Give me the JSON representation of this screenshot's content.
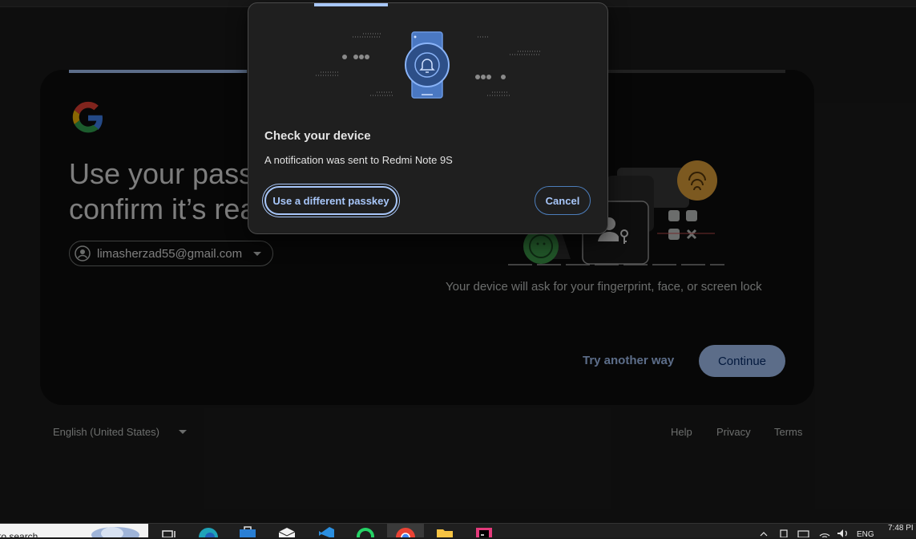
{
  "signin": {
    "headline": "Use your pass\nconfirm it’s rea",
    "account_email": "limasherzad55@gmail.com",
    "device_note": "Your device will ask for your fingerprint, face, or screen lock",
    "try_another": "Try another way",
    "continue": "Continue"
  },
  "footer": {
    "language": "English (United States)",
    "help": "Help",
    "privacy": "Privacy",
    "terms": "Terms"
  },
  "dialog": {
    "title": "Check your device",
    "body": "A notification was sent to Redmi Note 9S",
    "use_different_passkey": "Use a different passkey",
    "cancel": "Cancel"
  },
  "taskbar": {
    "search_text": "to search",
    "tray_lang": "ENG",
    "clock": "7:48 PI"
  },
  "colors": {
    "accent": "#a8c7fa",
    "background": "#1b1b1b",
    "dialog_bg": "#1f1f1f",
    "card_bg": "#0e0e0e"
  },
  "icons": {
    "google_logo": "google-logo",
    "account": "account-circle-icon",
    "phone": "phone-bell-icon",
    "fingerprint": "fingerprint-icon"
  }
}
